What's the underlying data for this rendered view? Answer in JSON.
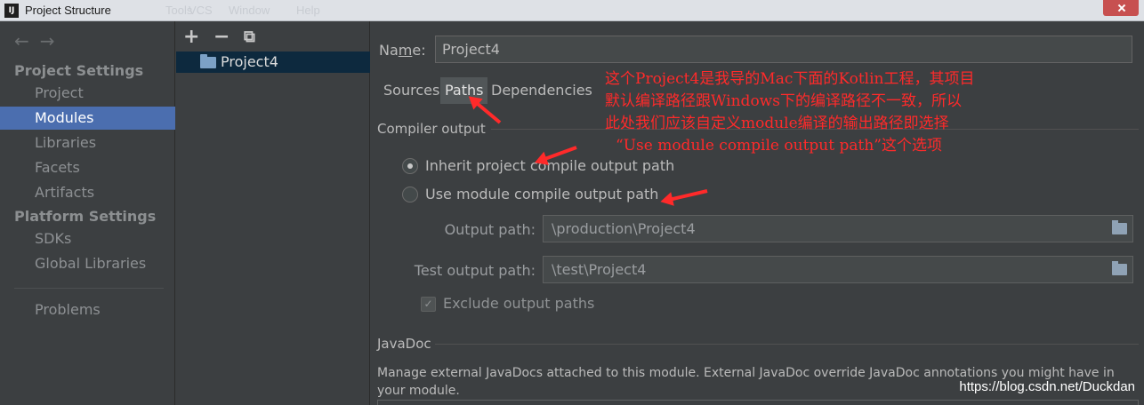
{
  "window": {
    "title": "Project Structure",
    "app_icon": "intellij-icon",
    "background_menu": [
      "Tools",
      "VCS",
      "Window",
      "Help"
    ]
  },
  "sidebar": {
    "back_icon": "←",
    "forward_icon": "→",
    "groups": [
      {
        "header": "Project Settings",
        "items": [
          "Project",
          "Modules",
          "Libraries",
          "Facets",
          "Artifacts"
        ]
      },
      {
        "header": "Platform Settings",
        "items": [
          "SDKs",
          "Global Libraries"
        ]
      }
    ],
    "problems": "Problems",
    "selected": "Modules"
  },
  "modules_panel": {
    "add_icon": "+",
    "remove_icon": "−",
    "copy_icon": "⧉",
    "module_name": "Project4"
  },
  "content": {
    "name_label_prefix": "Na",
    "name_label_mnemonic": "m",
    "name_label_suffix": "e:",
    "name_value": "Project4",
    "tabs": [
      "Sources",
      "Paths",
      "Dependencies"
    ],
    "active_tab": "Paths",
    "compiler_output": {
      "title": "Compiler output",
      "inherit_label": "Inherit project compile output path",
      "module_label": "Use module compile output path",
      "selected": "inherit",
      "output_path_label": "Output path:",
      "output_path_value": "\\production\\Project4",
      "test_output_path_label": "Test output path:",
      "test_output_path_value": "\\test\\Project4",
      "exclude_label": "Exclude output paths",
      "exclude_checked": true
    },
    "javadoc": {
      "title": "JavaDoc",
      "description": "Manage external JavaDocs attached to this module. External JavaDoc override JavaDoc annotations you might have in your module."
    }
  },
  "annotation": {
    "lines": [
      "这个Project4是我导的Mac下面的Kotlin工程，其项目",
      "默认编译路径跟Windows下的编译路径不一致，所以",
      "此处我们应该自定义module编译的输出路径即选择",
      "“Use module compile output path”这个选项"
    ],
    "color": "#ff2a2a"
  },
  "watermark": "https://blog.csdn.net/Duckdan",
  "colors": {
    "background": "#3c3f41",
    "selection": "#4b6eaf",
    "module_row": "#0d293e"
  }
}
